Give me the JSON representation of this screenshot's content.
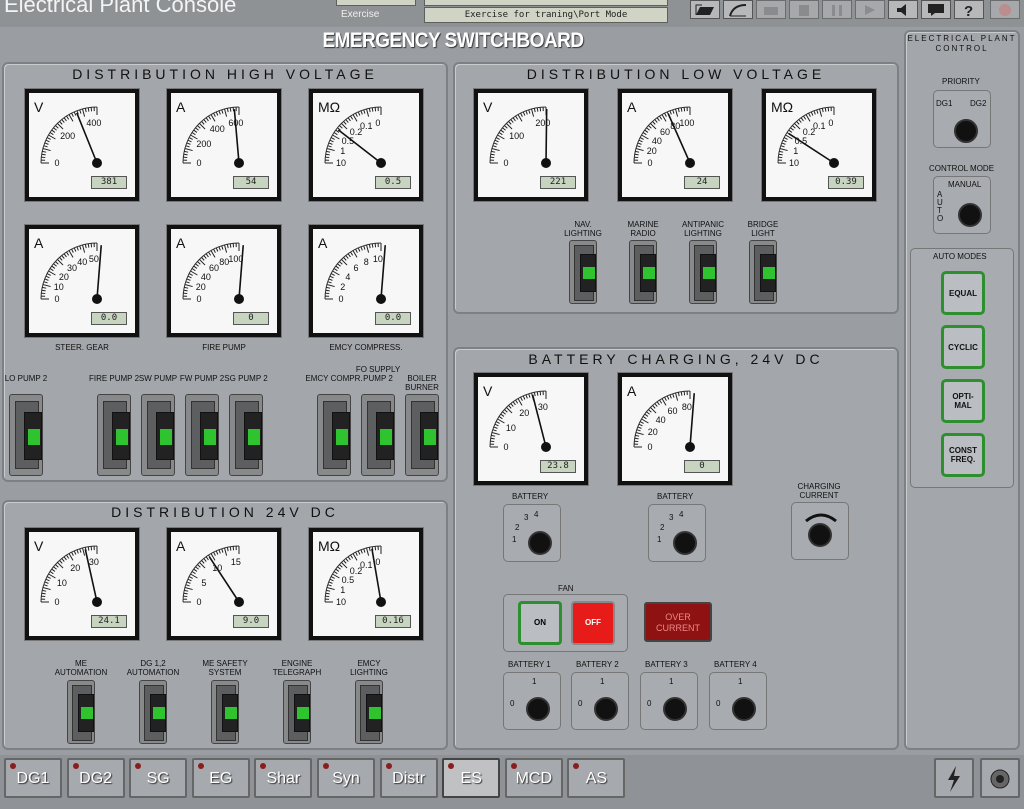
{
  "app": {
    "title": "Electrical Plant Console",
    "exercise_label": "Exercise",
    "exercise_value": "Exercise for traning\\Port Mode"
  },
  "console_title": "EMERGENCY SWITCHBOARD",
  "panels": {
    "hv": "DISTRIBUTION HIGH VOLTAGE",
    "lv": "DISTRIBUTION LOW VOLTAGE",
    "dc24": "DISTRIBUTION 24V DC",
    "batt": "BATTERY CHARGING, 24V DC"
  },
  "meters": {
    "hv_v": {
      "unit": "V",
      "reading": "381",
      "ticks": [
        "0",
        "200",
        "400"
      ]
    },
    "hv_a": {
      "unit": "A",
      "reading": "54",
      "ticks": [
        "0",
        "200",
        "400",
        "600"
      ]
    },
    "hv_mohm": {
      "unit": "MΩ",
      "reading": "0.5",
      "ticks": [
        "10",
        "1",
        "0.5",
        "0.2",
        "0.1",
        "0"
      ]
    },
    "steer": {
      "unit": "A",
      "reading": "0.0",
      "ticks": [
        "0",
        "10",
        "20",
        "30",
        "40",
        "50"
      ],
      "label": "STEER. GEAR"
    },
    "firepump": {
      "unit": "A",
      "reading": "0",
      "ticks": [
        "0",
        "20",
        "40",
        "60",
        "80",
        "100"
      ],
      "label": "FIRE PUMP"
    },
    "emcy": {
      "unit": "A",
      "reading": "0.0",
      "ticks": [
        "0",
        "2",
        "4",
        "6",
        "8",
        "10"
      ],
      "label": "EMCY COMPRESS."
    },
    "lv_v": {
      "unit": "V",
      "reading": "221",
      "ticks": [
        "0",
        "100",
        "200"
      ]
    },
    "lv_a": {
      "unit": "A",
      "reading": "24",
      "ticks": [
        "0",
        "20",
        "40",
        "60",
        "80",
        "100"
      ]
    },
    "lv_mohm": {
      "unit": "MΩ",
      "reading": "0.39",
      "ticks": [
        "10",
        "1",
        "0.5",
        "0.2",
        "0.1",
        "0"
      ]
    },
    "dc_v": {
      "unit": "V",
      "reading": "24.1",
      "ticks": [
        "0",
        "10",
        "20",
        "30"
      ]
    },
    "dc_a": {
      "unit": "A",
      "reading": "9.0",
      "ticks": [
        "0",
        "5",
        "10",
        "15"
      ]
    },
    "dc_mohm": {
      "unit": "MΩ",
      "reading": "0.16",
      "ticks": [
        "10",
        "1",
        "0.5",
        "0.2",
        "0.1",
        "0"
      ]
    },
    "bat_v": {
      "unit": "V",
      "reading": "23.8",
      "ticks": [
        "0",
        "10",
        "20",
        "30"
      ]
    },
    "bat_a": {
      "unit": "A",
      "reading": "0",
      "ticks": [
        "0",
        "20",
        "40",
        "60",
        "80"
      ]
    }
  },
  "hv_switches": [
    "LO PUMP 2",
    "FIRE PUMP 2",
    "SW PUMP",
    "FW PUMP 2",
    "SG PUMP 2",
    "EMCY COMPR.",
    "FO SUPPLY PUMP 2",
    "BOILER BURNER"
  ],
  "lv_switches": [
    "NAV. LIGHTING",
    "MARINE RADIO",
    "ANTIPANIC LIGHTING",
    "BRIDGE LIGHT"
  ],
  "dc_switches": [
    "ME AUTOMATION",
    "DG 1,2 AUTOMATION",
    "ME SAFETY SYSTEM",
    "ENGINE TELEGRAPH",
    "EMCY LIGHTING"
  ],
  "battery": {
    "battery_label": "BATTERY",
    "charging_current": "CHARGING CURRENT",
    "fan": "FAN",
    "fan_on": "ON",
    "fan_off": "OFF",
    "over_current": "OVER CURRENT",
    "selectors": [
      "BATTERY 1",
      "BATTERY 2",
      "BATTERY 3",
      "BATTERY 4"
    ],
    "selector_positions": [
      "0",
      "1"
    ],
    "battery_positions": [
      "1",
      "2",
      "3",
      "4"
    ]
  },
  "plant_control": {
    "title": "ELECTRICAL PLANT CONTROL",
    "priority": "PRIORITY",
    "dg1": "DG1",
    "dg2": "DG2",
    "control_mode": "CONTROL MODE",
    "manual": "MANUAL",
    "auto": "AUTO",
    "auto_modes": "AUTO MODES",
    "modes": [
      "EQUAL",
      "CYCLIC",
      "OPTI-MAL",
      "CONST FREQ."
    ]
  },
  "nav": [
    "DG1",
    "DG2",
    "SG",
    "EG",
    "Shar",
    "Syn",
    "Distr",
    "ES",
    "MCD",
    "AS"
  ],
  "colors": {
    "led_green": "#2fc42f",
    "fan_off_red": "#e81b1b",
    "over_current_red": "#8e1212",
    "mode_border": "#2e8f2e"
  }
}
